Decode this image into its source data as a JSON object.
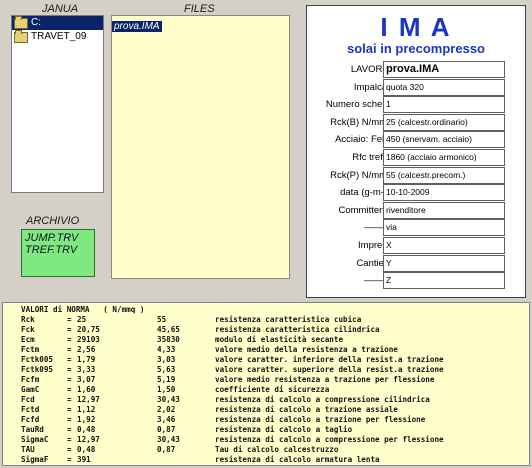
{
  "left": {
    "janua_label": "JANUA",
    "files_label": "FILES",
    "dirs": [
      {
        "label": "C:",
        "selected": true
      },
      {
        "label": "TRAVET_09",
        "selected": false
      }
    ],
    "files": [
      "prova.IMA"
    ],
    "archivio_label": "ARCHIVIO",
    "archive_files": [
      "JUMP.TRV",
      "TREF.TRV"
    ]
  },
  "header": {
    "title": "I M A",
    "subtitle": "solai in precompresso"
  },
  "form": [
    {
      "label": "LAVORO :",
      "value": "prova.IMA"
    },
    {
      "label": "Impalcato",
      "value": "quota 320"
    },
    {
      "label": "Numero schemi:",
      "value": "1"
    },
    {
      "label": "Rck(B) N/mmq:",
      "value": "25 (calcestr.ordinario)"
    },
    {
      "label": "Acciaio: Fek =",
      "value": "450 (snervam. acciaio)"
    },
    {
      "label": "Rfc trefoli:",
      "value": "1860 (acciaio armonico)"
    },
    {
      "label": "Rck(P) N/mmq:",
      "value": "55 (calcestr.precom.)"
    },
    {
      "label": "data (g-m-a):",
      "value": "10-10-2009"
    },
    {
      "label": "Committente:",
      "value": "rivenditore"
    },
    {
      "label": "———:",
      "value": "via"
    },
    {
      "label": "Impresa:",
      "value": "X"
    },
    {
      "label": "Cantiere:",
      "value": "Y"
    },
    {
      "label": "———:",
      "value": "Z"
    }
  ],
  "norma": {
    "header": "VALORI di NORMA   ( N/mmq )",
    "rows": [
      {
        "name": "Rck",
        "eq": "=",
        "v1": "25",
        "v2": "55",
        "desc": "resistenza caratteristica cubica"
      },
      {
        "name": "Fck",
        "eq": "=",
        "v1": "20,75",
        "v2": "45,65",
        "desc": "resistenza caratteristica cilindrica"
      },
      {
        "name": "Ecm",
        "eq": "=",
        "v1": "29103",
        "v2": "35830",
        "desc": "modulo di elasticità secante"
      },
      {
        "name": "Fctm",
        "eq": "=",
        "v1": "2,56",
        "v2": "4,33",
        "desc": "valore medio della resistenza a trazione"
      },
      {
        "name": "Fctk005",
        "eq": "=",
        "v1": "1,79",
        "v2": "3,03",
        "desc": "valore caratter. inferiore della resist.a trazione"
      },
      {
        "name": "Fctk095",
        "eq": "=",
        "v1": "3,33",
        "v2": "5,63",
        "desc": "valore caratter. superiore della resist.a trazione"
      },
      {
        "name": "Fcfm",
        "eq": "=",
        "v1": "3,07",
        "v2": "5,19",
        "desc": "valore medio resistenza a trazione per flessione"
      },
      {
        "name": "GamC",
        "eq": "=",
        "v1": "1,60",
        "v2": "1,50",
        "desc": "coefficiente di sicurezza"
      },
      {
        "name": "Fcd",
        "eq": "=",
        "v1": "12,97",
        "v2": "30,43",
        "desc": "resistenza di calcolo a compressione  cilindrica"
      },
      {
        "name": "Fctd",
        "eq": "=",
        "v1": "1,12",
        "v2": "2,02",
        "desc": "resistenza di calcolo a trazione assiale"
      },
      {
        "name": "Fcfd",
        "eq": "=",
        "v1": "1,92",
        "v2": "3,46",
        "desc": "resistenza di calcolo a trazione per flessione"
      },
      {
        "name": "TauRd",
        "eq": "=",
        "v1": "0,48",
        "v2": "0,87",
        "desc": "resistenza di calcolo a taglio"
      },
      {
        "name": "SigmaC",
        "eq": "=",
        "v1": "12,97",
        "v2": "30,43",
        "desc": "resistenza di calcolo a compressione per flessione"
      },
      {
        "name": "TAU",
        "eq": "=",
        "v1": "0,48",
        "v2": "0,87",
        "desc": "Tau di calcolo calcestruzzo"
      },
      {
        "name": "SigmaF",
        "eq": "=",
        "v1": "391",
        "v2": "",
        "desc": "resistenza di calcolo armatura lenta"
      }
    ]
  }
}
